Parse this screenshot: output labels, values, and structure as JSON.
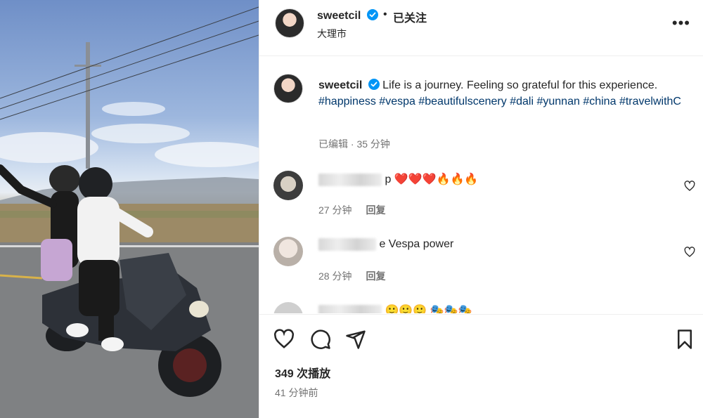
{
  "post": {
    "username": "sweetcil",
    "separator": "•",
    "follow_status": "已关注",
    "location": "大理市",
    "more_icon": "more-horizontal-icon"
  },
  "caption": {
    "username": "sweetcil",
    "text": "Life is a journey. Feeling so grateful for this experience.",
    "hashtags": [
      "#happiness",
      "#vespa",
      "#beautifulscenery",
      "#dali",
      "#yunnan",
      "#china",
      "#travelwithC"
    ],
    "edited": "已编辑",
    "time": "35 分钟"
  },
  "comments": [
    {
      "visible_text": "p ❤️❤️❤️🔥🔥🔥",
      "time": "27 分钟",
      "reply": "回复"
    },
    {
      "visible_text": "e Vespa power",
      "time": "28 分钟",
      "reply": "回复"
    },
    {
      "visible_text": "🙂🙂🙂 🎭🎭🎭",
      "time": "",
      "reply": ""
    }
  ],
  "footer": {
    "plays": "349 次播放",
    "ago": "41 分钟前"
  },
  "colors": {
    "verified": "#0095f6",
    "hashtag": "#00376b",
    "secondary_text": "#737373"
  }
}
